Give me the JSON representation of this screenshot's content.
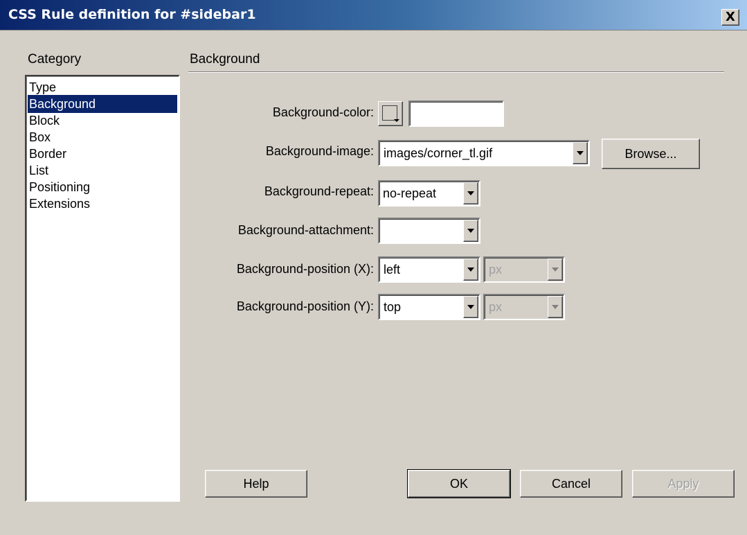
{
  "window": {
    "title": "CSS Rule definition for #sidebar1",
    "close_label": "X"
  },
  "category": {
    "label": "Category",
    "items": [
      "Type",
      "Background",
      "Block",
      "Box",
      "Border",
      "List",
      "Positioning",
      "Extensions"
    ],
    "selected": "Background"
  },
  "section": {
    "title": "Background"
  },
  "fields": {
    "bg_color": {
      "label": "Background-color:",
      "value": ""
    },
    "bg_image": {
      "label": "Background-image:",
      "value": "images/corner_tl.gif",
      "browse_label": "Browse..."
    },
    "bg_repeat": {
      "label": "Background-repeat:",
      "value": "no-repeat"
    },
    "bg_attachment": {
      "label": "Background-attachment:",
      "value": ""
    },
    "bg_pos_x": {
      "label": "Background-position (X):",
      "value": "left",
      "unit": "px"
    },
    "bg_pos_y": {
      "label": "Background-position (Y):",
      "value": "top",
      "unit": "px"
    }
  },
  "buttons": {
    "help": "Help",
    "ok": "OK",
    "cancel": "Cancel",
    "apply": "Apply"
  }
}
